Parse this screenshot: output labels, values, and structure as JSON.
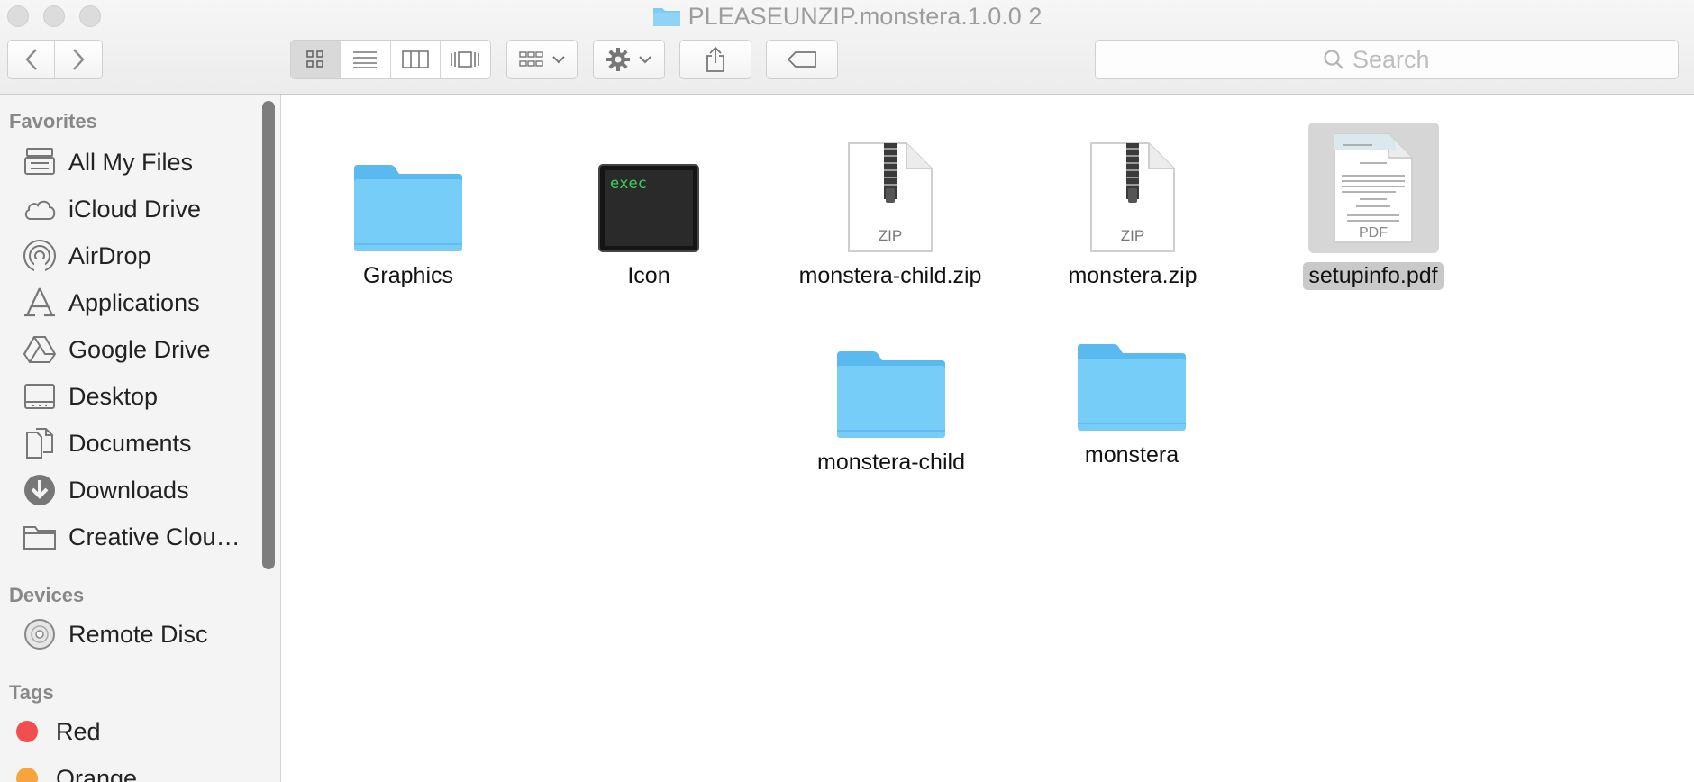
{
  "window": {
    "title": "PLEASEUNZIP.monstera.1.0.0 2"
  },
  "toolbar": {
    "back_icon": "chevron-left-icon",
    "forward_icon": "chevron-right-icon",
    "view_modes": [
      "icon-view",
      "list-view",
      "column-view",
      "cover-flow-view"
    ],
    "active_view": "icon-view",
    "search_placeholder": "Search"
  },
  "sidebar": {
    "favorites_title": "Favorites",
    "favorites": [
      {
        "label": "All My Files",
        "icon": "all-files-icon"
      },
      {
        "label": "iCloud Drive",
        "icon": "cloud-icon"
      },
      {
        "label": "AirDrop",
        "icon": "airdrop-icon"
      },
      {
        "label": "Applications",
        "icon": "applications-icon"
      },
      {
        "label": "Google Drive",
        "icon": "google-drive-icon"
      },
      {
        "label": "Desktop",
        "icon": "desktop-icon"
      },
      {
        "label": "Documents",
        "icon": "documents-icon"
      },
      {
        "label": "Downloads",
        "icon": "downloads-icon"
      },
      {
        "label": "Creative Clou…",
        "icon": "folder-icon"
      }
    ],
    "devices_title": "Devices",
    "devices": [
      {
        "label": "Remote Disc",
        "icon": "disc-icon"
      }
    ],
    "tags_title": "Tags",
    "tags": [
      {
        "label": "Red",
        "color": "#f24e4e"
      },
      {
        "label": "Orange",
        "color": "#f5a53a"
      }
    ]
  },
  "files": [
    {
      "name": "Graphics",
      "kind": "folder-icon",
      "selected": false
    },
    {
      "name": "Icon",
      "kind": "exec-icon",
      "badge": "exec",
      "selected": false
    },
    {
      "name": "monstera-child.zip",
      "kind": "zip-icon",
      "badge": "ZIP",
      "selected": false
    },
    {
      "name": "monstera.zip",
      "kind": "zip-icon",
      "badge": "ZIP",
      "selected": false
    },
    {
      "name": "setupinfo.pdf",
      "kind": "pdf-icon",
      "badge": "PDF",
      "selected": true
    },
    {
      "name": "monstera-child",
      "kind": "folder-icon",
      "selected": false
    },
    {
      "name": "monstera",
      "kind": "folder-icon",
      "selected": false
    }
  ],
  "colors": {
    "folder": "#6cc4f3",
    "selection": "#c9c9c9"
  }
}
